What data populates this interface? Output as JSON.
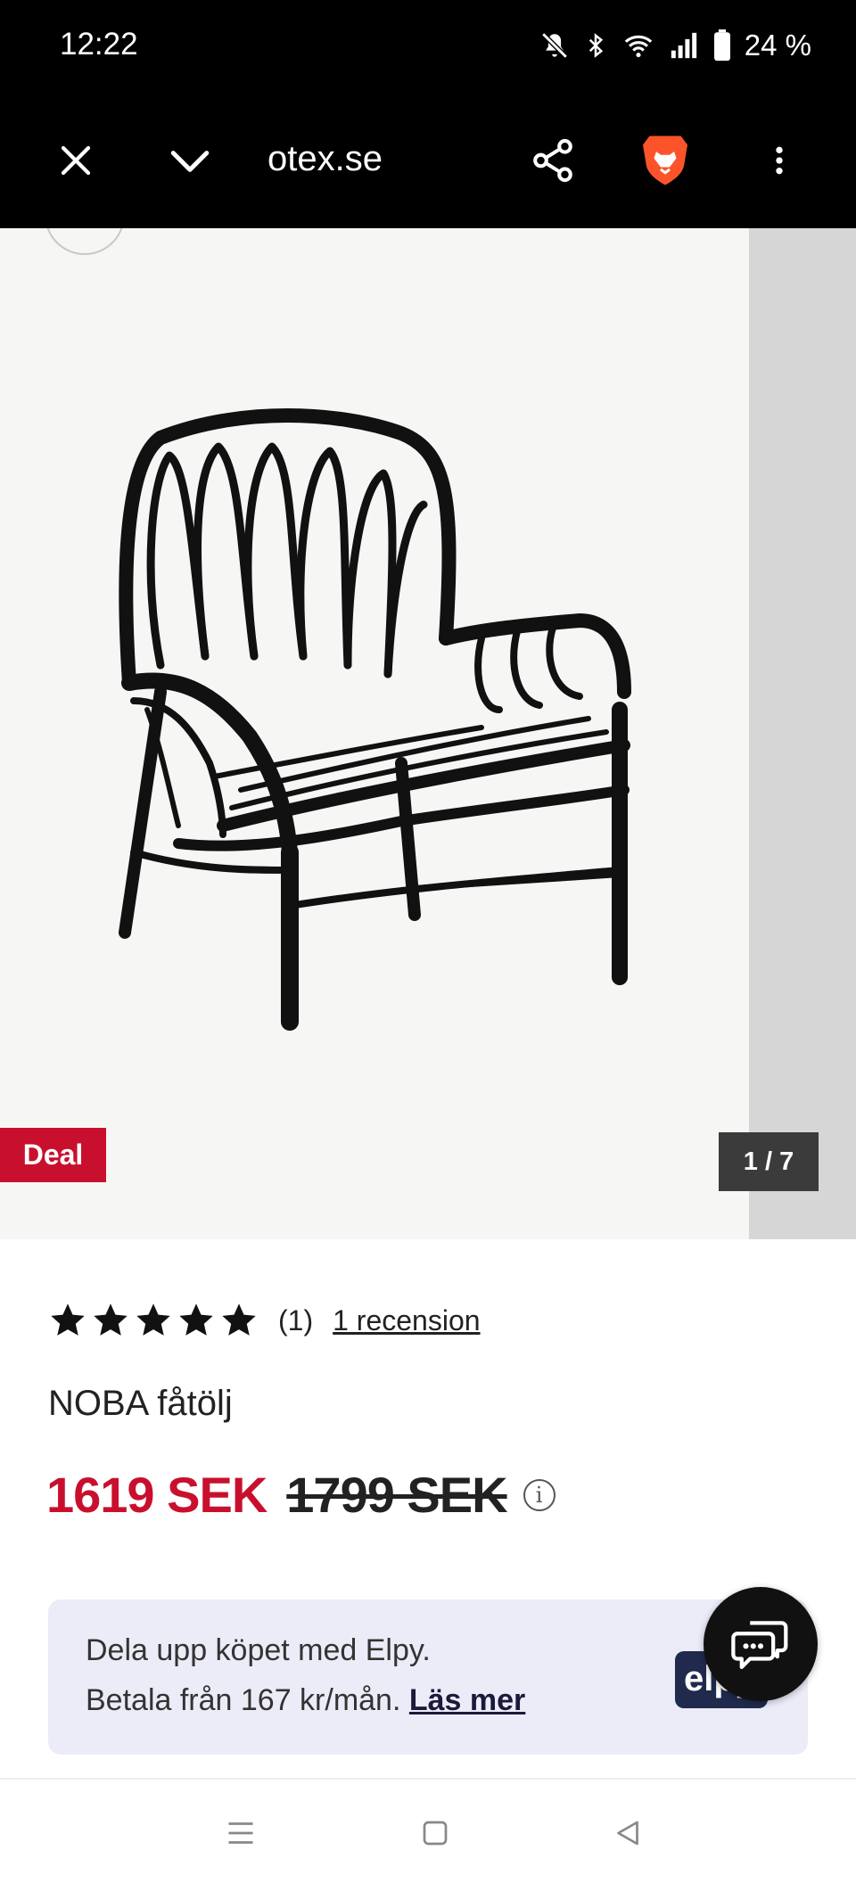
{
  "status_bar": {
    "time": "12:22",
    "battery": "24 %",
    "icons": [
      "mute-icon",
      "bluetooth-icon",
      "wifi-icon",
      "signal-icon",
      "battery-icon"
    ]
  },
  "toolbar": {
    "url": "otex.se",
    "icons": [
      "close-icon",
      "chevron-down-icon",
      "share-icon",
      "brave-lion-icon",
      "more-vert-icon"
    ]
  },
  "gallery": {
    "badge": "Deal",
    "counter": "1 / 7"
  },
  "product": {
    "rating_stars": 5,
    "rating_count": "(1)",
    "review_link": "1 recension",
    "title": "NOBA fåtölj",
    "price_now": "1619 SEK",
    "price_old": "1799 SEK",
    "info_glyph": "i"
  },
  "elpy": {
    "line1": "Dela upp köpet med Elpy.",
    "line2": "Betala från 167 kr/mån.",
    "link": "Läs mer",
    "logo_text": "elpy"
  },
  "colors": {
    "accent_red": "#c8102e",
    "banner_bg": "#ececf9"
  }
}
